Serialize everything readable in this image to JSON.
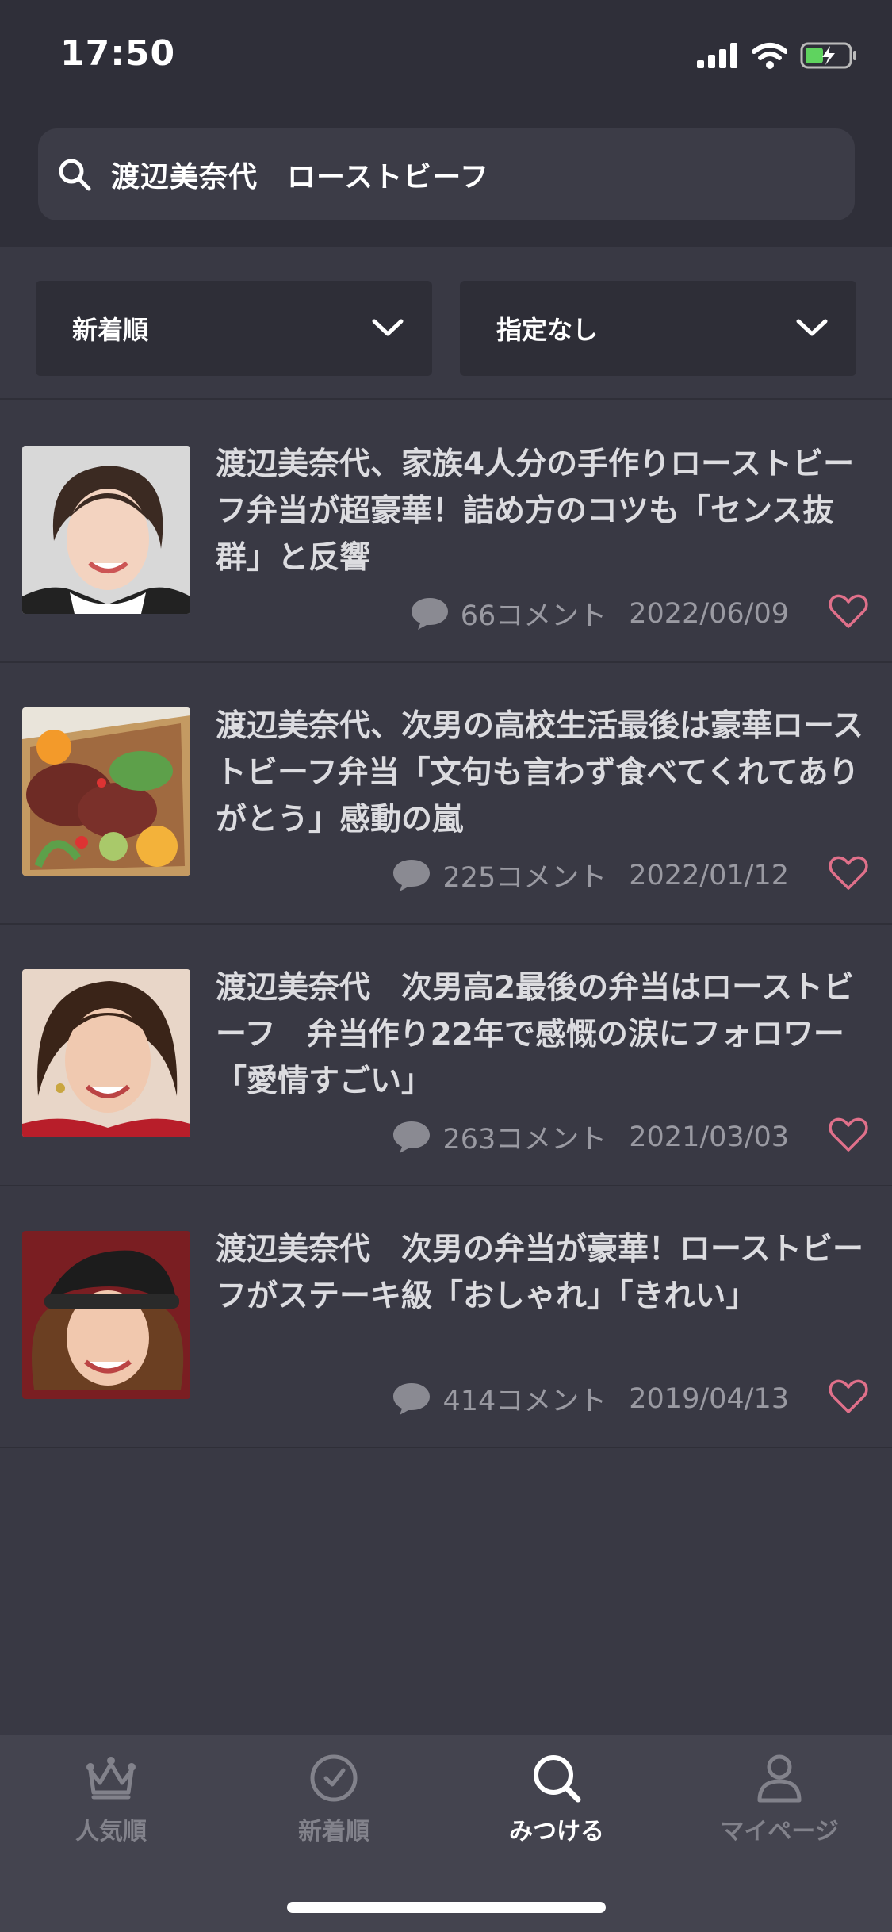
{
  "status": {
    "time": "17:50"
  },
  "search": {
    "query": "渡辺美奈代　ローストビーフ"
  },
  "filters": {
    "sort": "新着順",
    "period": "指定なし"
  },
  "articles": [
    {
      "title": "渡辺美奈代、家族4人分の手作りローストビーフ弁当が超豪華！詰め方のコツも「センス抜群」と反響",
      "comments": "66コメント",
      "date": "2022/06/09",
      "thumb": "portrait"
    },
    {
      "title": "渡辺美奈代、次男の高校生活最後は豪華ローストビーフ弁当「文句も言わず食べてくれてありがとう」感動の嵐",
      "comments": "225コメント",
      "date": "2022/01/12",
      "thumb": "food"
    },
    {
      "title": "渡辺美奈代　次男高2最後の弁当はローストビーフ　弁当作り22年で感慨の涙にフォロワー「愛情すごい」",
      "comments": "263コメント",
      "date": "2021/03/03",
      "thumb": "portrait"
    },
    {
      "title": "渡辺美奈代　次男の弁当が豪華！ローストビーフがステーキ級「おしゃれ」「きれい」",
      "comments": "414コメント",
      "date": "2019/04/13",
      "thumb": "portrait-cap"
    }
  ],
  "tabs": [
    {
      "label": "人気順",
      "icon": "crown-icon"
    },
    {
      "label": "新着順",
      "icon": "clock-icon"
    },
    {
      "label": "みつける",
      "icon": "search-icon"
    },
    {
      "label": "マイページ",
      "icon": "person-icon"
    }
  ],
  "colors": {
    "accent_heart": "#e0708a",
    "background": "#393944",
    "header": "#2f2f39"
  }
}
